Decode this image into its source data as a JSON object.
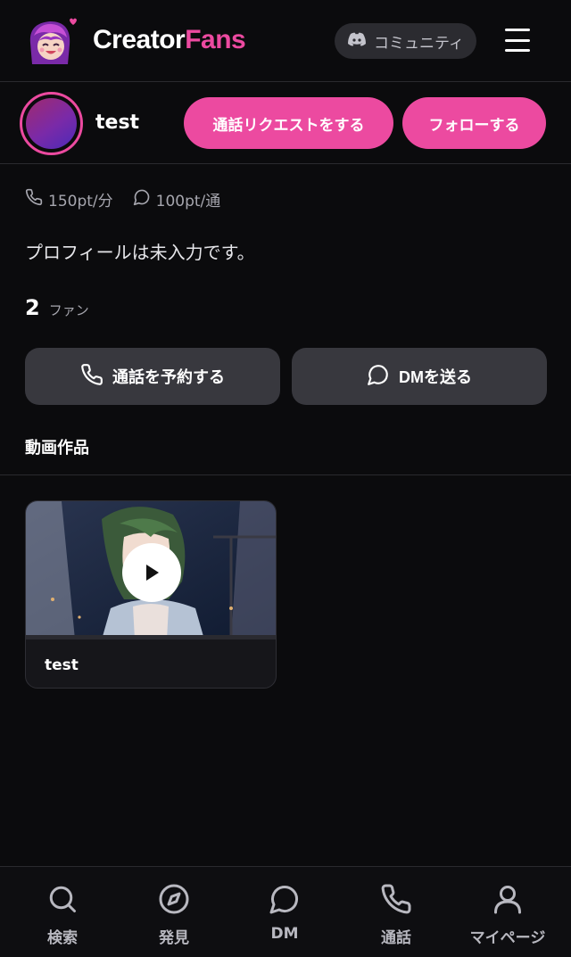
{
  "header": {
    "logo_text_1": "Creator",
    "logo_text_2": "Fans",
    "community_label": "コミュニティ"
  },
  "profile": {
    "name": "test",
    "call_request_label": "通話リクエストをする",
    "follow_label": "フォローする",
    "call_price": "150pt/分",
    "message_price": "100pt/通",
    "bio": "プロフィールは未入力です。",
    "fans_count": "2",
    "fans_label": "ファン",
    "reserve_call_label": "通話を予約する",
    "send_dm_label": "DMを送る"
  },
  "videos": {
    "section_title": "動画作品",
    "items": [
      {
        "title": "test"
      }
    ]
  },
  "nav": {
    "items": [
      {
        "label": "検索",
        "icon": "search-icon"
      },
      {
        "label": "発見",
        "icon": "compass-icon"
      },
      {
        "label": "DM",
        "icon": "chat-bubble-icon"
      },
      {
        "label": "通話",
        "icon": "phone-icon"
      },
      {
        "label": "マイページ",
        "icon": "user-icon"
      }
    ]
  },
  "colors": {
    "accent": "#ec4aa0",
    "background": "#0b0b0d",
    "button_gray": "#38383e"
  }
}
